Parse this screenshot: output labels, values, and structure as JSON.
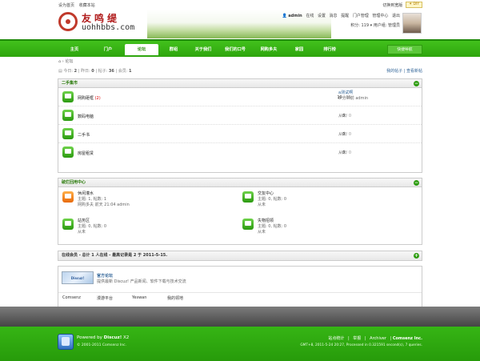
{
  "topbar": {
    "set_home": "设为首页",
    "bookmark": "收藏本站",
    "switch_style": "切换到宽版",
    "diy": "DIY"
  },
  "logo": {
    "cn_text": "友鸣缇",
    "en_text": "uohhbbs.com"
  },
  "user": {
    "name": "admin",
    "status": "在线",
    "links": [
      "设置",
      "消息",
      "提醒",
      "门户管理",
      "管理中心",
      "退出"
    ],
    "points": "积分: 119",
    "group": "用户组: 管理员"
  },
  "nav": {
    "items": [
      "主页",
      "门户",
      "论坛",
      "群组",
      "关于我们",
      "我们的口号",
      "网购多夫",
      "家园",
      "排行榜"
    ],
    "active_index": 2,
    "quick": "快捷导航"
  },
  "breadcrumb": {
    "sep": "›",
    "current": "论坛"
  },
  "stats": {
    "today_label": "今日:",
    "today": "2",
    "yesterday_label": "昨日:",
    "yesterday": "0",
    "posts_label": "帖子:",
    "posts": "36",
    "members_label": "会员:",
    "members": "1",
    "my_posts": "我的帖子",
    "new_posts": "查看新帖"
  },
  "cat1": {
    "title": "二手集市",
    "forums": [
      {
        "name": "网购砸框",
        "today": "(2)",
        "count1": "19",
        "count2": "35",
        "last1": "a测试啊",
        "last2": "8 分钟前 admin"
      },
      {
        "name": "数码电脑",
        "today": "",
        "count1": "0",
        "count2": "0",
        "last1": "从未",
        "last2": ""
      },
      {
        "name": "二手书",
        "today": "",
        "count1": "0",
        "count2": "0",
        "last1": "从未",
        "last2": ""
      },
      {
        "name": "房屋租赁",
        "today": "",
        "count1": "0",
        "count2": "0",
        "last1": "从未",
        "last2": ""
      }
    ]
  },
  "cat2": {
    "title": "破烂回用中心",
    "forums": [
      {
        "name": "休闲灌水",
        "stat": "主题: 1, 帖数: 1",
        "last": "网购多夫 前天 21:04 admin"
      },
      {
        "name": "交友中心",
        "stat": "主题: 0, 帖数: 0",
        "last": "从未"
      },
      {
        "name": "站务区",
        "stat": "主题: 0, 帖数: 0",
        "last": "从未"
      },
      {
        "name": "失物招领",
        "stat": "主题: 0, 帖数: 0",
        "last": "从未"
      }
    ]
  },
  "online": {
    "title": "在线会员 - 总计 1 人在线 - 最高记录是 2 于 2011-5-15."
  },
  "links": {
    "logo_text": "Discuz!",
    "name": "官方论坛",
    "desc": "提供最新 Discuz! 产品新闻、软件下载与技术交流",
    "text_links": [
      "Comsenz",
      "漫游平台",
      "Yeswan",
      "我的领地"
    ]
  },
  "footer": {
    "powered_prefix": "Powered by",
    "powered_name": "Discuz!",
    "version": "X2",
    "copyright": "© 2001-2011 Comsenz Inc.",
    "links": [
      "站点统计",
      "举报",
      "Archiver",
      "Comsenz Inc."
    ],
    "seps": [
      "|",
      "|",
      "|"
    ],
    "info": "GMT+8, 2011-5-24 20:27, Processed in 0.321591 second(s), 7 queries."
  },
  "colors": {
    "nav_green": "#2ea50d",
    "footer_green": "#279b0a",
    "title_green": "#2a7a0a"
  }
}
